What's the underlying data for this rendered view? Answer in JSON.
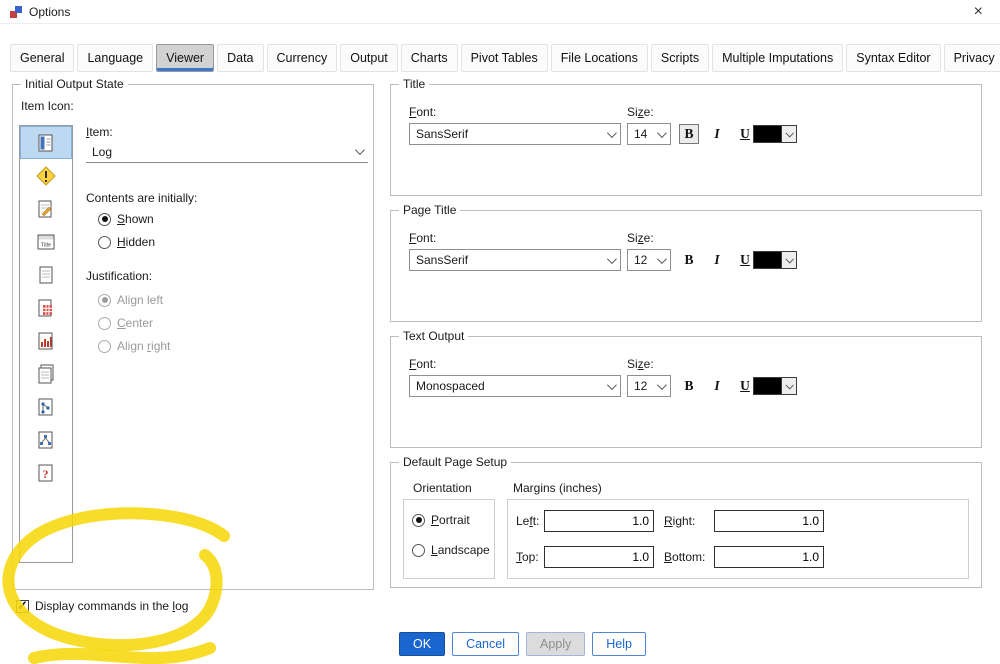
{
  "window": {
    "title": "Options",
    "close_glyph": "×"
  },
  "tabs": [
    "General",
    "Language",
    "Viewer",
    "Data",
    "Currency",
    "Output",
    "Charts",
    "Pivot Tables",
    "File Locations",
    "Scripts",
    "Multiple Imputations",
    "Syntax Editor",
    "Privacy"
  ],
  "active_tab": "Viewer",
  "colors": {
    "accent_blue": "#1a66cf",
    "selection_blue": "#bdd9f2",
    "warning_yellow": "#ffd23e",
    "marker_yellow": "#f6d70b",
    "font_color_swatch": "#000000"
  },
  "initial_output": {
    "group_title": "Initial Output State",
    "item_icon_label": "Item Icon:",
    "item_icons": [
      "log-icon",
      "warning-icon",
      "note-icon",
      "title-icon",
      "page-icon",
      "calculator-icon",
      "bar-chart-icon",
      "notes-icon",
      "tree-icon",
      "model-icon",
      "help-icon"
    ],
    "selected_icon": "log-icon",
    "item_label": "&Item:",
    "item_value": "Log",
    "contents_label": "Contents are initially:",
    "shown_label": "&Shown",
    "hidden_label": "&Hidden",
    "contents_selected": "Shown",
    "justification_label": "Justification:",
    "align_left_label": "Align left",
    "center_label": "&Center",
    "align_right_label": "Align &right",
    "justification_selected": "Align left",
    "justification_enabled": false,
    "display_commands_label": "Display commands in the &log",
    "display_commands_checked": true
  },
  "title_group": {
    "title": "Title",
    "font_label": "&Font:",
    "font_value": "SansSerif",
    "size_label": "Si&ze:",
    "size_value": "14",
    "bold": "B",
    "italic": "I",
    "underline": "U",
    "color": "#000000"
  },
  "page_title_group": {
    "title": "Page Title",
    "font_label": "&Font:",
    "font_value": "SansSerif",
    "size_label": "Si&ze:",
    "size_value": "12",
    "bold": "B",
    "italic": "I",
    "underline": "U",
    "color": "#000000"
  },
  "text_output_group": {
    "title": "Text Output",
    "font_label": "&Font:",
    "font_value": "Monospaced",
    "size_label": "Si&ze:",
    "size_value": "12",
    "bold": "B",
    "italic": "I",
    "underline": "U",
    "color": "#000000"
  },
  "page_setup": {
    "title": "Default Page Setup",
    "orientation_label": "Orientation",
    "portrait_label": "&Portrait",
    "landscape_label": "&Landscape",
    "orientation_selected": "Portrait",
    "margins_label": "Margins (inches)",
    "left_label": "Le&ft:",
    "left_value": "1.0",
    "right_label": "&Right:",
    "right_value": "1.0",
    "top_label": "&Top:",
    "top_value": "1.0",
    "bottom_label": "&Bottom:",
    "bottom_value": "1.0"
  },
  "buttons": {
    "ok": "OK",
    "cancel": "Cancel",
    "apply": "Apply",
    "help": "Help"
  },
  "annotation": {
    "type": "hand-drawn-marker-circle",
    "color": "#f6d70b",
    "target": "Display commands in the log checkbox"
  }
}
